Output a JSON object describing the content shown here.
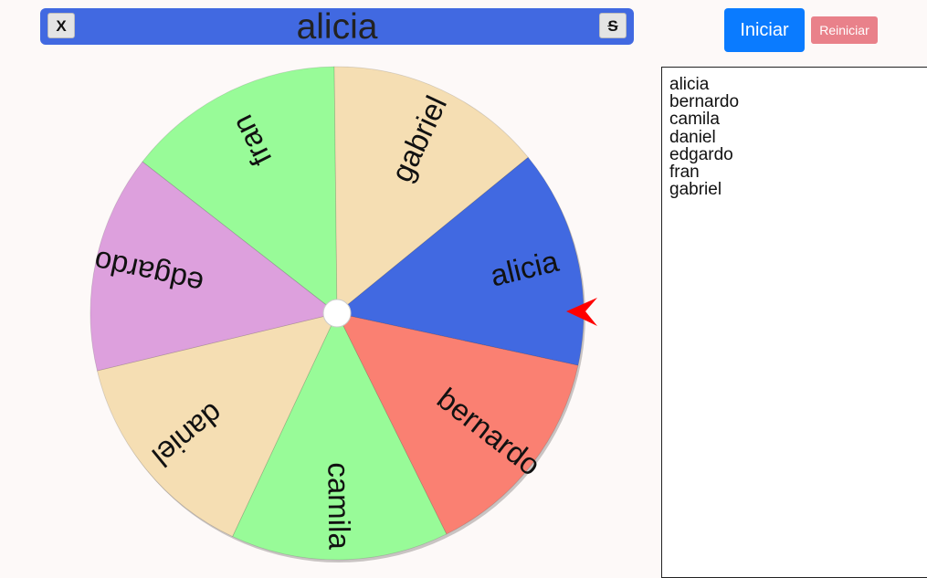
{
  "header": {
    "winner": "alicia",
    "close_label": "X",
    "s_label": "S"
  },
  "controls": {
    "start_label": "Iniciar",
    "reset_label": "Reiniciar"
  },
  "names": [
    "alicia",
    "bernardo",
    "camila",
    "daniel",
    "edgardo",
    "fran",
    "gabriel"
  ],
  "wheel": {
    "segments": [
      {
        "label": "alicia",
        "color": "#4169e1"
      },
      {
        "label": "bernardo",
        "color": "#fa8072"
      },
      {
        "label": "camila",
        "color": "#98fb98"
      },
      {
        "label": "daniel",
        "color": "#f5deb3"
      },
      {
        "label": "edgardo",
        "color": "#dda0dd"
      },
      {
        "label": "fran",
        "color": "#98fb98"
      },
      {
        "label": "gabriel",
        "color": "#f5deb3"
      }
    ],
    "pointer_color": "#ff0000"
  }
}
